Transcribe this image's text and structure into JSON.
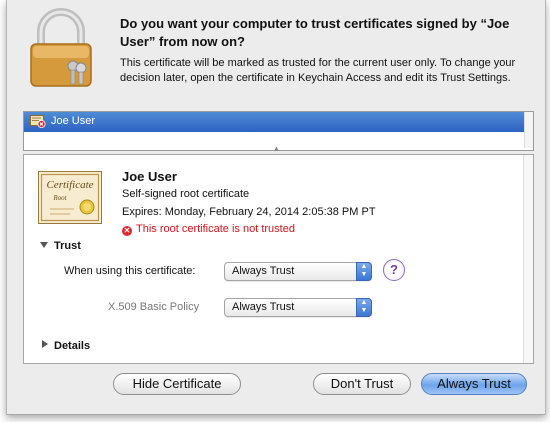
{
  "dialog": {
    "headline": "Do you want your computer to trust certificates signed by “Joe User” from now on?",
    "explanation": "This certificate will be marked as trusted for the current user only. To change your decision later, open the certificate in Keychain Access and edit its Trust Settings."
  },
  "certificate_list": {
    "items": [
      {
        "label": "Joe User",
        "icon": "certificate-error-icon"
      }
    ]
  },
  "certificate": {
    "image_text": {
      "line1": "Certificate",
      "line2": "Root"
    },
    "name": "Joe User",
    "kind": "Self-signed root certificate",
    "expires": "Expires: Monday, February 24, 2014 2:05:38 PM PT",
    "warning": "This root certificate is not trusted"
  },
  "trust": {
    "section_label": "Trust",
    "when_using_label": "When using this certificate:",
    "when_using_value": "Always Trust",
    "policy_label": "X.509 Basic Policy",
    "policy_value": "Always Trust",
    "help": "?"
  },
  "details": {
    "section_label": "Details"
  },
  "buttons": {
    "hide_certificate": "Hide Certificate",
    "dont_trust": "Don't Trust",
    "always_trust": "Always Trust"
  },
  "colors": {
    "selection": "#3b72cc",
    "warning": "#d0141b",
    "default_button": "#6da4ec"
  }
}
